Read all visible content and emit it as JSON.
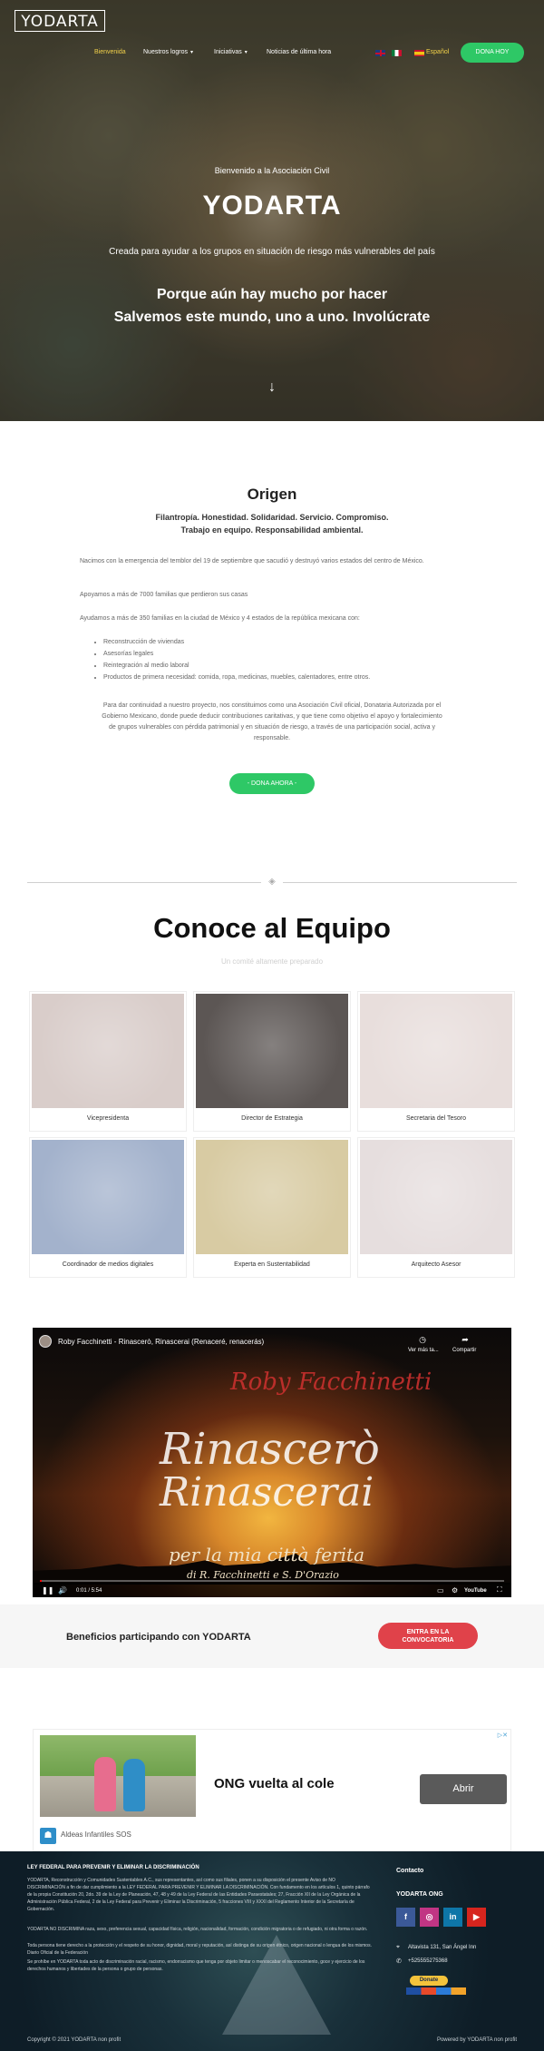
{
  "colors": {
    "accent_green": "#2ec866",
    "accent_red": "#e0424a",
    "nav_active": "#f2d14a",
    "footer_bg": "#0e1d27"
  },
  "header": {
    "logo": "YODARTA",
    "nav": [
      {
        "label": "Bienvenida",
        "active": true
      },
      {
        "label": "Nuestros logros",
        "dropdown": true
      },
      {
        "label": "Iniciativas",
        "dropdown": true
      },
      {
        "label": "Noticias de última hora"
      }
    ],
    "lang_flags": [
      "flag-uk-icon",
      "flag-mexico-icon",
      "flag-spain-icon"
    ],
    "lang_label": "Español",
    "donate_label": "DONA HOY"
  },
  "hero": {
    "welcome": "Bienvenido a la Asociación Civil",
    "title": "YODARTA",
    "subtitle": "Creada para ayudar a los grupos en situación de riesgo más vulnerables del país",
    "line1": "Porque aún hay mucho por hacer",
    "line2": "Salvemos este mundo, uno a uno. Involúcrate",
    "scroll_icon": "arrow-down-icon"
  },
  "origen": {
    "title": "Origen",
    "values_line1": "Filantropía. Honestidad. Solidaridad. Servicio. Compromiso.",
    "values_line2": "Trabajo en equipo. Responsabilidad ambiental.",
    "p1": "Nacimos con la emergencia del temblor del 19 de septiembre que sacudió y destruyó varios estados del centro de México.",
    "p2": "Apoyamos a más de 7000 familias que perdieron sus casas",
    "p3": "Ayudamos a más de 350 familias en  la ciudad de México y 4 estados de la república mexicana con:",
    "bullets": [
      "Reconstrucción de viviendas",
      "Asesorías legales",
      "Reintegración al medio laboral",
      "Productos de primera necesidad: comida, ropa, medicinas, muebles, calentadores, entre otros."
    ],
    "p4": "Para dar continuidad a nuestro proyecto, nos constituimos como una Asociación Civil oficial, Donataria Autorizada por el Gobierno Mexicano, donde puede deducir contribuciones caritativas, y que tiene como objetivo el apoyo y fortalecimiento de grupos vulnerables con pérdida patrimonial y en situación de riesgo, a través de una participación social, activa y responsable.",
    "donate_label": "- DONA AHORA -"
  },
  "team": {
    "title": "Conoce al Equipo",
    "subtitle": "Un comité altamente preparado",
    "members": [
      {
        "role": "Vicepresidenta",
        "photo_color": "#d9cdca"
      },
      {
        "role": "Director de Estrategia",
        "photo_color": "#5c5654"
      },
      {
        "role": "Secretaria del Tesoro",
        "photo_color": "#e8dedc"
      },
      {
        "role": "Coordinador de medios digitales",
        "photo_color": "#a3b2cc"
      },
      {
        "role": "Experta en Sustentabilidad",
        "photo_color": "#d8cba3"
      },
      {
        "role": "Arquitecto Asesor",
        "photo_color": "#e6dede"
      }
    ]
  },
  "video": {
    "title": "Roby Facchinetti - Rinascerò, Rinascerai (Renaceré, renacerás)",
    "watch_later": "Ver más ta...",
    "share": "Compartir",
    "overlay_artist": "Roby Facchinetti",
    "overlay_l1": "Rinascerò",
    "overlay_l2": "Rinascerai",
    "overlay_l3": "per la mia città ferita",
    "overlay_l4": "di R. Facchinetti e S. D'Orazio",
    "time": "0:01 / 5:54",
    "progress": 0.003,
    "youtube_label": "YouTube"
  },
  "beneficios": {
    "text": "Beneficios participando con YODARTA",
    "button_line1": "ENTRA EN LA",
    "button_line2": "CONVOCATORIA"
  },
  "ad": {
    "headline": "ONG vuelta al cole",
    "button": "Abrir",
    "advertiser": "Aldeas Infantiles SOS"
  },
  "footer": {
    "heading": "LEY FEDERAL PARA PREVENIR Y ELIMINAR LA DISCRIMINACIÓN",
    "p1": "YODARTA, Reconstrucción y Comunidades Sustentables A.C., sus representantes, así como sus filiales, ponen a su disposición el presente Aviso de NO DISCRIMINACIÓN a fin de dar cumplimiento a la LEY FEDERAL PARA PREVENIR Y ELIMINAR LA DISCRIMINACIÓN. Con fundamento en los artículos 1, quinto párrafo de la propia Constitución 20, 2do. 39 de la Ley de Planeación, 47, 48 y 49 de la Ley Federal de las Entidades Paraestatales; 27, Fracción XII de la Ley Orgánica de la Administración Pública Federal, 2 de la Ley Federal para Prevenir y Eliminar la Discriminación, 5 fracciones VIII y XXXI del Reglamento Interior de la Secretaría de Gobernación.",
    "p2": "YODARTA NO DISCRIMINA raza, sexo, preferencia sexual, capacidad física, religión, nacionalidad, formación, condición migratoria o de refugiado, ni otra forma o razón.",
    "p3": "Toda persona tiene derecho a la protección y el respeto de su honor, dignidad, moral y reputación, así distinga de su origen étnico, origen nacional o lengua de los mismos. Diario Oficial de la Federación",
    "p4": "Se prohíbe en YODARTA toda acto de discriminación racial, racismo, endorracismo que tenga por objeto limitar o menoscabar el reconocimiento, goce y ejercicio de los derechos humanos y libertades de la persona o grupo de personas.",
    "contact_title": "Contacto",
    "org": "YODARTA ONG",
    "social": [
      {
        "icon": "facebook-icon",
        "glyph": "f",
        "color": "#3b5998"
      },
      {
        "icon": "instagram-icon",
        "glyph": "◎",
        "color": "#c13584"
      },
      {
        "icon": "linkedin-icon",
        "glyph": "in",
        "color": "#0e76a8"
      },
      {
        "icon": "youtube-icon",
        "glyph": "▶",
        "color": "#d7251e"
      }
    ],
    "address": "Altavista 131, San Ángel Inn",
    "phone": "+525555275368",
    "donate": "Donate",
    "copyright": "Copyright © 2021 YODARTA non profit",
    "powered": "Powered by YODARTA non profit"
  }
}
